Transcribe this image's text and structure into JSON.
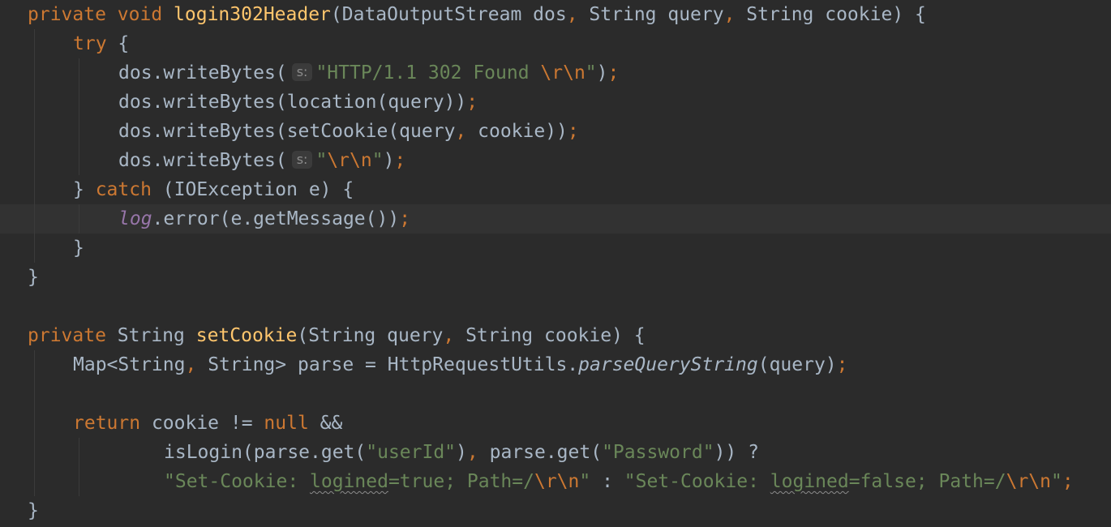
{
  "editor": {
    "l1": {
      "private": "private",
      "void": "void",
      "method_name": "login302Header",
      "open_paren": "(DataOutputStream dos",
      "comma1": ",",
      "param2": " String query",
      "comma2": ",",
      "param3": " String cookie) {"
    },
    "l2": {
      "try": "try",
      "brace": " {"
    },
    "l3": {
      "call": "dos.writeBytes(",
      "hint": "s:",
      "string": "\"HTTP/1.1 302 Found ",
      "escape": "\\r\\n",
      "string_end": "\"",
      "close": ")",
      "semi": ";"
    },
    "l4": {
      "code": "dos.writeBytes(location(query))",
      "semi": ";"
    },
    "l5": {
      "code1": "dos.writeBytes(setCookie(query",
      "comma": ",",
      "code2": " cookie))",
      "semi": ";"
    },
    "l6": {
      "call": "dos.writeBytes(",
      "hint": "s:",
      "string": "\"",
      "escape": "\\r\\n",
      "string_end": "\"",
      "close": ")",
      "semi": ";"
    },
    "l7": {
      "brace": "} ",
      "catch": "catch",
      "rest": " (IOException e) {"
    },
    "l8": {
      "field": "log",
      "rest": ".error(e.getMessage())",
      "semi": ";"
    },
    "l9": {
      "brace": "}"
    },
    "l10": {
      "brace": "}"
    },
    "l12": {
      "private": "private",
      "type": " String ",
      "method_name": "setCookie",
      "params1": "(String query",
      "comma": ",",
      "params2": " String cookie) {"
    },
    "l13": {
      "part1": "Map<String",
      "comma": ",",
      "part2": " String> parse = HttpRequestUtils.",
      "static_call": "parseQueryString",
      "part3": "(query)",
      "semi": ";"
    },
    "l15": {
      "return": "return",
      "mid": " cookie != ",
      "null": "null",
      "and": " &&"
    },
    "l16": {
      "part1": "isLogin(parse.get(",
      "str1": "\"userId\"",
      "part2": ")",
      "comma": ",",
      "part3": " parse.get(",
      "str2": "\"Password\"",
      "part4": ")) ?"
    },
    "l17": {
      "s1a": "\"Set-Cookie: ",
      "s1b": "logined",
      "s1c": "=true; Path=/",
      "esc1": "\\r\\n",
      "s1d": "\"",
      "colon": " : ",
      "s2a": "\"Set-Cookie: ",
      "s2b": "logined",
      "s2c": "=false; Path=/",
      "esc2": "\\r\\n",
      "s2d": "\"",
      "semi": ";"
    },
    "l18": {
      "brace": "}"
    }
  },
  "colors": {
    "background": "#2b2b2b",
    "keyword": "#cc7832",
    "method_declaration": "#ffc66d",
    "string": "#6a8759",
    "field": "#9876aa",
    "default_text": "#a9b7c6",
    "current_line": "#323232"
  }
}
